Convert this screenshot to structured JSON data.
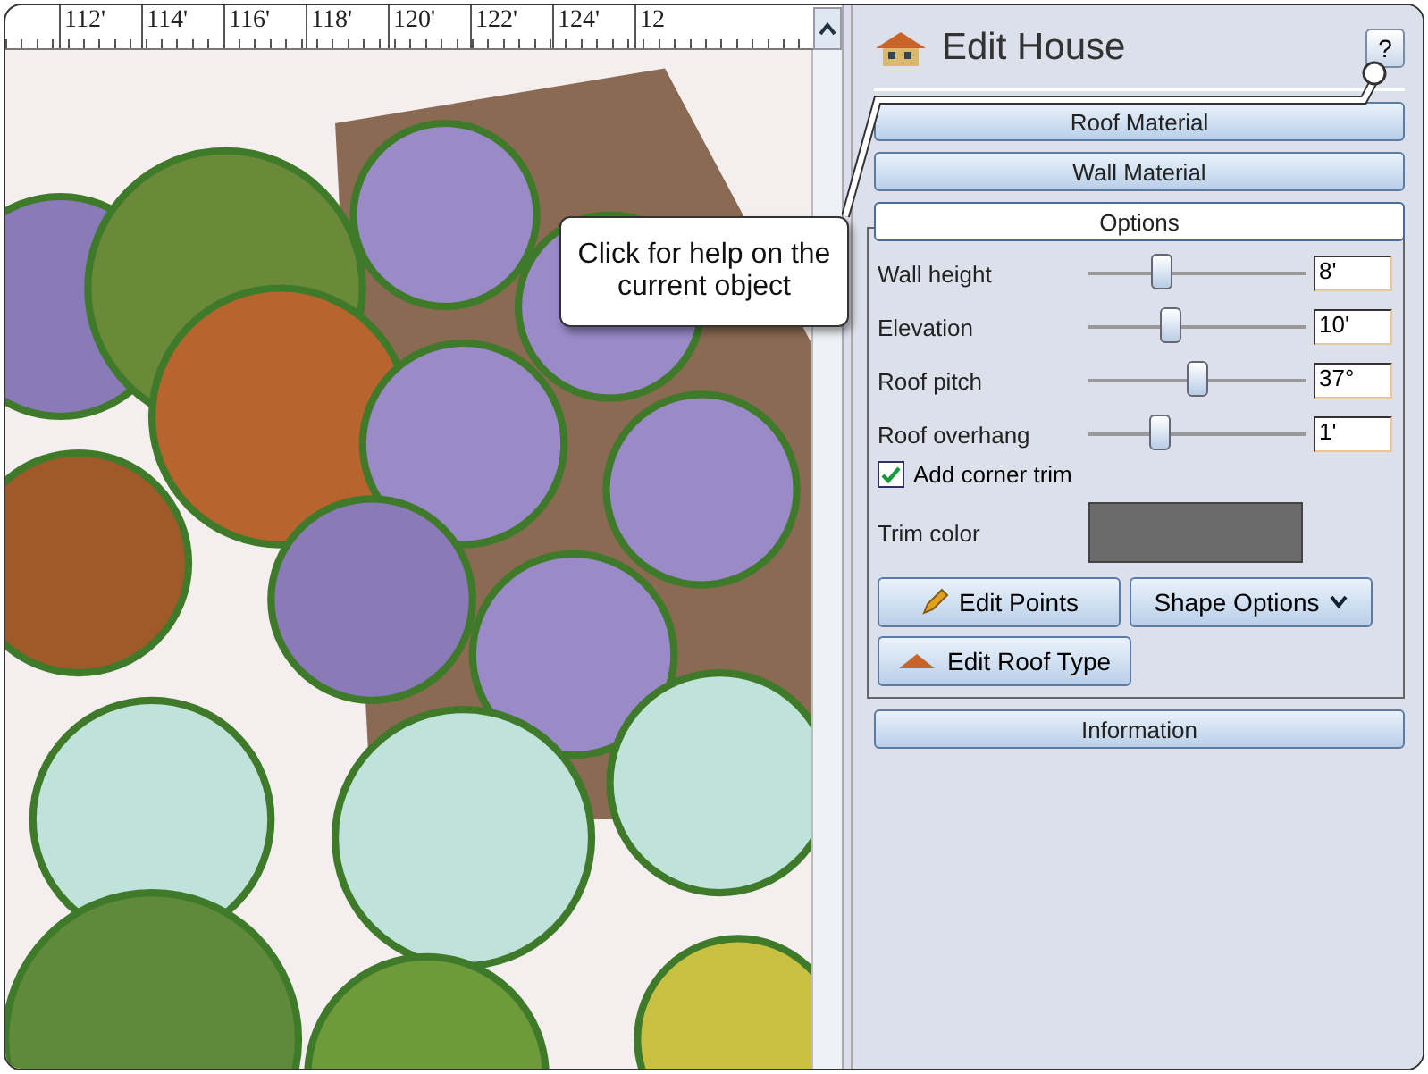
{
  "ruler": {
    "labels": [
      "112'",
      "114'",
      "116'",
      "118'",
      "120'",
      "122'",
      "124'",
      "12"
    ]
  },
  "callout": {
    "text": "Click for help on the current object"
  },
  "panel": {
    "title": "Edit House",
    "help_button": "?",
    "sections": [
      {
        "label": "Roof Material",
        "expanded": false
      },
      {
        "label": "Wall Material",
        "expanded": false
      },
      {
        "label": "Options",
        "expanded": true
      }
    ],
    "sliders": [
      {
        "label": "Wall height",
        "level": 0.34,
        "value": "8'"
      },
      {
        "label": "Elevation",
        "level": 0.38,
        "value": "10'"
      },
      {
        "label": "Roof pitch",
        "level": 0.5,
        "value": "37°"
      },
      {
        "label": "Roof overhang",
        "level": 0.33,
        "value": "1'"
      }
    ],
    "corner_trim": {
      "label": "Add corner trim",
      "checked": true
    },
    "trim_color": {
      "label": "Trim color",
      "color": "#6b6b6b"
    },
    "buttons": [
      {
        "label": "Edit Points",
        "kind": "pencil"
      },
      {
        "label": "Shape Options",
        "kind": "dropdown"
      },
      {
        "label": "Edit Roof Type",
        "kind": "roof"
      }
    ],
    "information": {
      "label": "Information",
      "expanded": false
    }
  }
}
